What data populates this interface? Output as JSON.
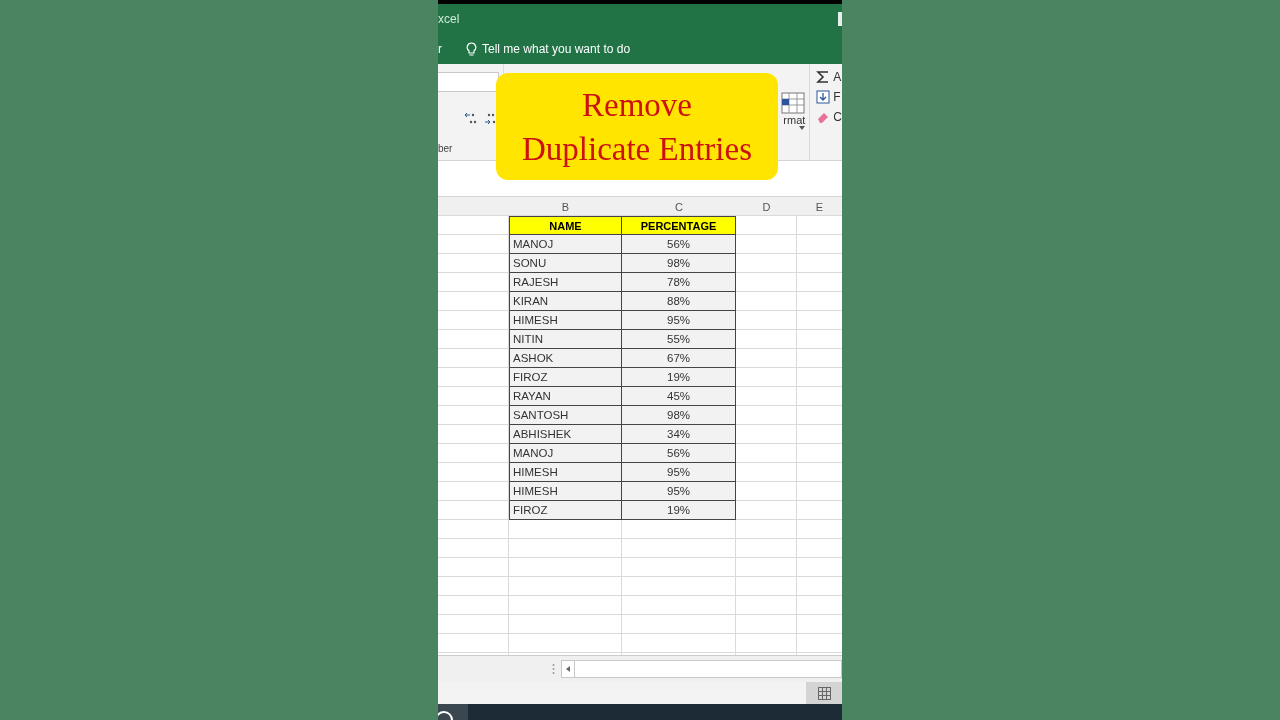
{
  "title_bar": {
    "title": "xcel"
  },
  "ribbon": {
    "tab_fragment": "r",
    "tell_me": "Tell me what you want to do",
    "group_label": "ber",
    "format_label": "rmat",
    "editing": [
      {
        "kind": "sum",
        "label": "A"
      },
      {
        "kind": "fill",
        "label": "F"
      },
      {
        "kind": "clear",
        "label": "C"
      }
    ]
  },
  "overlay": {
    "lines": [
      "Remove",
      "Duplicate Entries"
    ]
  },
  "sheet": {
    "columns": [
      "B",
      "C",
      "D",
      "E"
    ],
    "table_header": [
      "NAME",
      "PERCENTAGE"
    ],
    "rows": [
      {
        "name": "MANOJ",
        "percentage": "56%"
      },
      {
        "name": "SONU",
        "percentage": "98%"
      },
      {
        "name": "RAJESH",
        "percentage": "78%"
      },
      {
        "name": "KIRAN",
        "percentage": "88%"
      },
      {
        "name": "HIMESH",
        "percentage": "95%"
      },
      {
        "name": "NITIN",
        "percentage": "55%"
      },
      {
        "name": "ASHOK",
        "percentage": "67%"
      },
      {
        "name": "FIROZ",
        "percentage": "19%"
      },
      {
        "name": "RAYAN",
        "percentage": "45%"
      },
      {
        "name": "SANTOSH",
        "percentage": "98%"
      },
      {
        "name": "ABHISHEK",
        "percentage": "34%"
      },
      {
        "name": "MANOJ",
        "percentage": "56%"
      },
      {
        "name": "HIMESH",
        "percentage": "95%"
      },
      {
        "name": "HIMESH",
        "percentage": "95%"
      },
      {
        "name": "FIROZ",
        "percentage": "19%"
      }
    ]
  }
}
